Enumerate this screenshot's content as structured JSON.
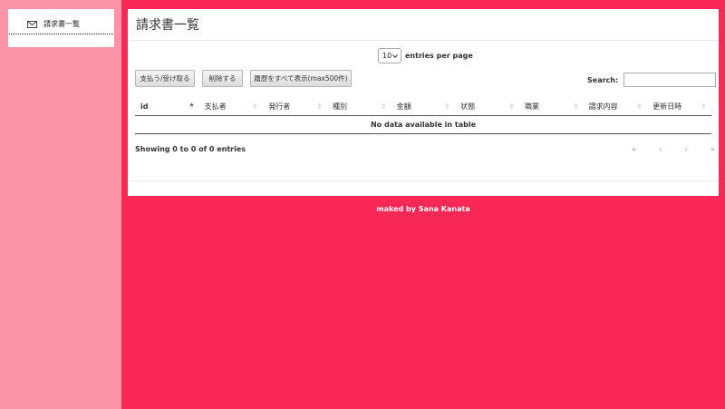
{
  "sidebar": {
    "items": [
      {
        "label": "請求書一覧",
        "icon": "envelope-icon"
      }
    ]
  },
  "panel": {
    "title": "請求書一覧"
  },
  "table_controls": {
    "page_length": "10",
    "page_length_suffix": "entries per page",
    "search_label": "Search:",
    "search_value": ""
  },
  "buttons": {
    "pay_receive": "支払う/受け取る",
    "delete": "削除する",
    "show_all_history": "履歴をすべて表示(max500件)"
  },
  "table": {
    "columns": [
      "id",
      "支払者",
      "発行者",
      "種別",
      "金額",
      "状態",
      "職業",
      "請求内容",
      "更新日時"
    ],
    "empty_message": "No data available in table"
  },
  "pagination": {
    "info": "Showing 0 to 0 of 0 entries",
    "first": "«",
    "prev": "‹",
    "next": "›",
    "last": "»"
  },
  "footer": {
    "text": "maked by Sana Kanata"
  },
  "colors": {
    "background": "#fa2856",
    "sidebar": "#fb93a6",
    "panel": "#ffffff"
  }
}
